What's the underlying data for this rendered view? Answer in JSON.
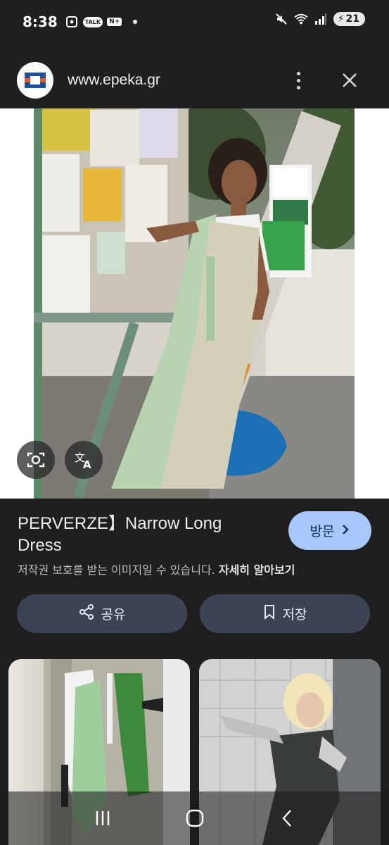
{
  "status": {
    "time": "8:38",
    "talk_badge": "TALK",
    "news_badge": "N+",
    "battery": "21"
  },
  "header": {
    "url": "www.epeka.gr"
  },
  "product": {
    "title": "PERVERZE】Narrow Long Dress",
    "visit_label": "방문",
    "copyright_text": "저작권 보호를 받는 이미지일 수 있습니다.",
    "learn_more": "자세히 알아보기"
  },
  "actions": {
    "share_label": "공유",
    "save_label": "저장"
  },
  "icons": [
    "camera-lens-icon",
    "translate-icon",
    "share-icon",
    "bookmark-icon",
    "chevron-right-icon",
    "more-vert-icon",
    "close-icon",
    "mute-icon",
    "wifi-icon",
    "signal-icon",
    "recents-icon",
    "home-icon",
    "back-icon"
  ],
  "colors": {
    "background": "#1f1f1f",
    "visit_button": "#a8c7fa",
    "action_button": "#3b4354"
  }
}
